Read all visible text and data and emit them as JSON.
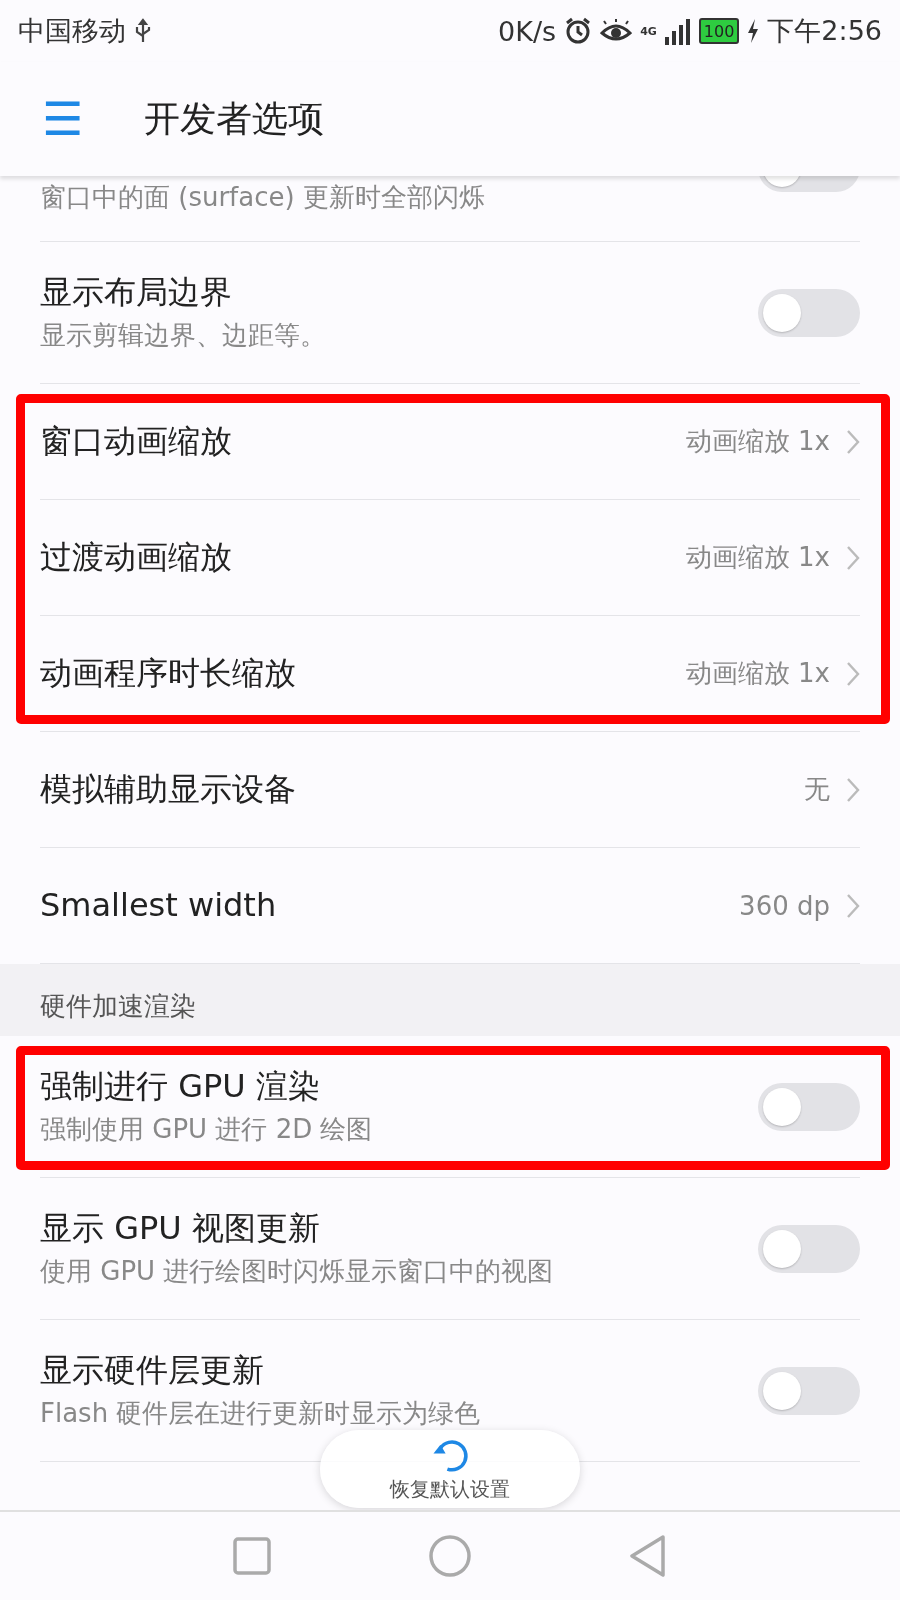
{
  "status_bar": {
    "carrier": "中国移动",
    "speed": "0K/s",
    "network": "4G",
    "battery": "100",
    "time": "下午2:56"
  },
  "header": {
    "menu_icon": "☰",
    "title": "开发者选项"
  },
  "groups": [
    {
      "highlighted": false,
      "items": [
        {
          "kind": "toggle",
          "subtitle": "窗口中的面 (surface) 更新时全部闪烁",
          "on": false,
          "partial": true
        },
        {
          "kind": "toggle",
          "title": "显示布局边界",
          "subtitle": "显示剪辑边界、边距等。",
          "on": false
        }
      ]
    },
    {
      "highlighted": true,
      "items": [
        {
          "kind": "value",
          "title": "窗口动画缩放",
          "value": "动画缩放 1x"
        },
        {
          "kind": "value",
          "title": "过渡动画缩放",
          "value": "动画缩放 1x"
        },
        {
          "kind": "value",
          "title": "动画程序时长缩放",
          "value": "动画缩放 1x"
        }
      ]
    },
    {
      "highlighted": false,
      "items": [
        {
          "kind": "value",
          "title": "模拟辅助显示设备",
          "value": "无"
        },
        {
          "kind": "value",
          "title": "Smallest width",
          "value": "360 dp"
        }
      ]
    },
    {
      "section": "硬件加速渲染",
      "highlighted": true,
      "items": [
        {
          "kind": "toggle",
          "title": "强制进行 GPU 渲染",
          "subtitle": "强制使用 GPU 进行 2D 绘图",
          "on": false
        }
      ]
    },
    {
      "highlighted": false,
      "items": [
        {
          "kind": "toggle",
          "title": "显示 GPU 视图更新",
          "subtitle": "使用 GPU 进行绘图时闪烁显示窗口中的视图",
          "on": false
        },
        {
          "kind": "toggle",
          "title": "显示硬件层更新",
          "subtitle": "Flash 硬件层在进行更新时显示为绿色",
          "on": false
        }
      ]
    }
  ],
  "restore_button": "恢复默认设置"
}
